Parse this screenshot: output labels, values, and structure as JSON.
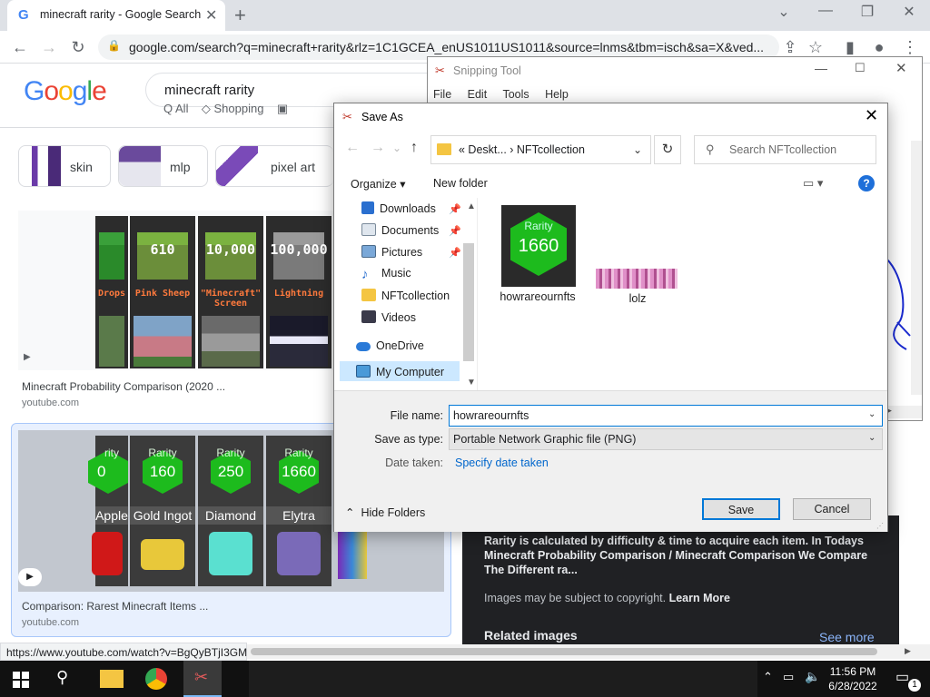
{
  "browser": {
    "tab_title": "minecraft rarity - Google Search",
    "url": "google.com/search?q=minecraft+rarity&rlz=1C1GCEA_enUS1011US1011&source=lnms&tbm=isch&sa=X&ved...",
    "status_url": "https://www.youtube.com/watch?v=BgQyBTjI3GM"
  },
  "google": {
    "logo": "Google",
    "query": "minecraft rarity",
    "chips": [
      "skin",
      "mlp",
      "pixel art"
    ],
    "results": [
      {
        "title": "Minecraft Probability Comparison (2020 ...",
        "source": "youtube.com",
        "cards": [
          {
            "value": "",
            "caption": "Drops"
          },
          {
            "value": "610",
            "caption": "Pink Sheep"
          },
          {
            "value": "10,000",
            "caption": "\"Minecraft\" Screen"
          },
          {
            "value": "100,000",
            "caption": "Lightning"
          }
        ]
      },
      {
        "title": "Comparison: Rarest Minecraft Items ...",
        "source": "youtube.com",
        "cards": [
          {
            "label": "rity",
            "value": "0",
            "name": "Apple"
          },
          {
            "label": "Rarity",
            "value": "160",
            "name": "Gold Ingot"
          },
          {
            "label": "Rarity",
            "value": "250",
            "name": "Diamond"
          },
          {
            "label": "Rarity",
            "value": "1660",
            "name": "Elytra"
          }
        ]
      }
    ],
    "side_panel": {
      "description": "Rarity is calculated by difficulty & time to acquire each item. In Todays Minecraft Probability Comparison / Minecraft Comparison We Compare The Different ra...",
      "copyright": "Images may be subject to copyright.",
      "learn_more": "Learn More",
      "related": "Related images",
      "see_more": "See more"
    }
  },
  "snipping_tool": {
    "title": "Snipping Tool",
    "menu": [
      "File",
      "Edit",
      "Tools",
      "Help"
    ]
  },
  "save_dialog": {
    "title": "Save As",
    "breadcrumb": "«  Deskt...  ›  NFTcollection",
    "search_placeholder": "Search NFTcollection",
    "organize": "Organize ▾",
    "new_folder": "New folder",
    "nav_items": [
      "Downloads",
      "Documents",
      "Pictures",
      "Music",
      "NFTcollection",
      "Videos",
      "OneDrive",
      "My Computer"
    ],
    "files": [
      {
        "name": "howrareournfts",
        "thumb_label": "Rarity",
        "thumb_value": "1660"
      },
      {
        "name": "lolz"
      }
    ],
    "file_name_label": "File name:",
    "file_name": "howrareournfts",
    "save_type_label": "Save as type:",
    "save_type": "Portable Network Graphic file (PNG)",
    "date_label": "Date taken:",
    "date_link": "Specify date taken",
    "hide_folders": "Hide Folders",
    "save": "Save",
    "cancel": "Cancel"
  },
  "taskbar": {
    "time": "11:56 PM",
    "date": "6/28/2022",
    "notif_count": "1"
  }
}
